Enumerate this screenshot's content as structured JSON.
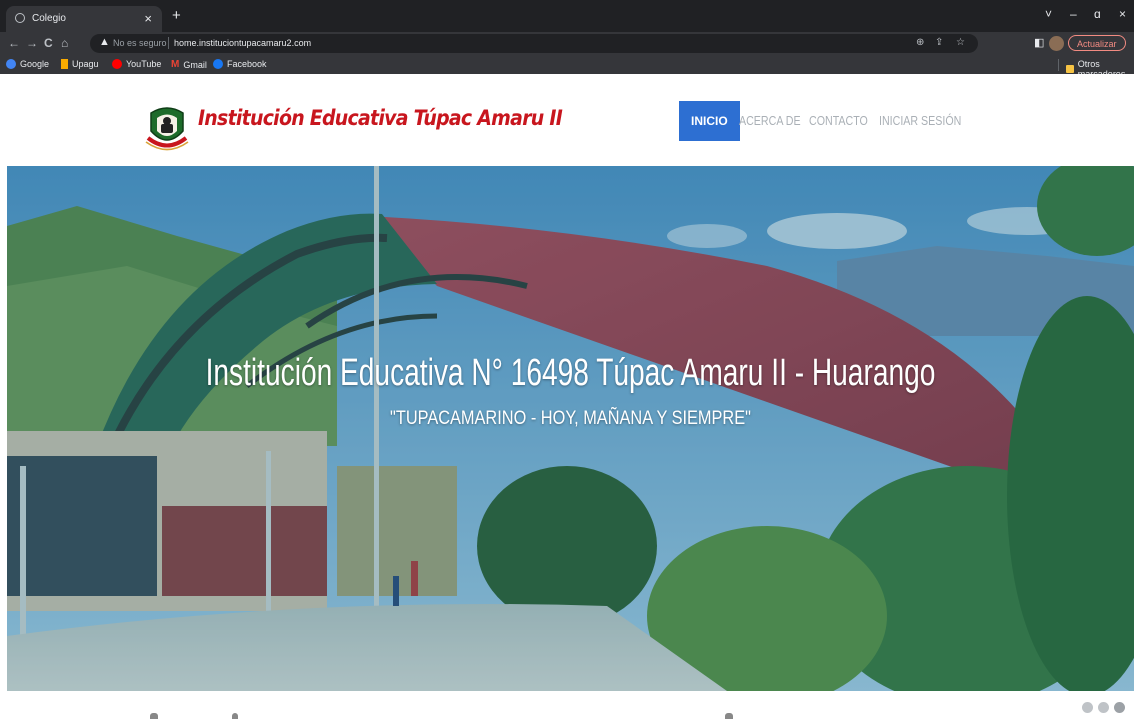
{
  "browser": {
    "tab": {
      "title": "Colegio",
      "close": "×"
    },
    "new_tab": "+",
    "window_controls": [
      "˅",
      "–",
      "ɑ",
      "×"
    ],
    "address": {
      "security_label": "No es seguro",
      "url": "home.instituciontupacamaru2.com"
    },
    "update_button": "Actualizar",
    "bookmarks": [
      {
        "label": "Google",
        "icon": "google-icon",
        "color": "#e8eaed"
      },
      {
        "label": "Upagu",
        "icon": "upagu-icon",
        "color": "#f9ab00"
      },
      {
        "label": "YouTube",
        "icon": "youtube-icon",
        "color": "#ff0000"
      },
      {
        "label": "Gmail",
        "icon": "gmail-icon",
        "color": "#ea4335"
      },
      {
        "label": "Facebook",
        "icon": "facebook-icon",
        "color": "#1877f2"
      }
    ],
    "other_bookmarks": "Otros marcadores"
  },
  "site": {
    "title": "Institución Educativa Túpac Amaru II",
    "nav": [
      {
        "label": "INICIO",
        "active": true
      },
      {
        "label": "ACERCA DE",
        "active": false
      },
      {
        "label": "CONTACTO",
        "active": false
      },
      {
        "label": "INICIAR SESIÓN",
        "active": false
      }
    ],
    "colors": {
      "brand": "#c8161e",
      "nav_active": "#2d6fd2"
    }
  },
  "hero": {
    "title": "Institución Educativa N° 16498 Túpac Amaru II - Huarango",
    "subtitle": "\"TUPACAMARINO - HOY, MAÑANA Y SIEMPRE\""
  },
  "carousel": {
    "slide_count": 3,
    "active_index": 2
  }
}
